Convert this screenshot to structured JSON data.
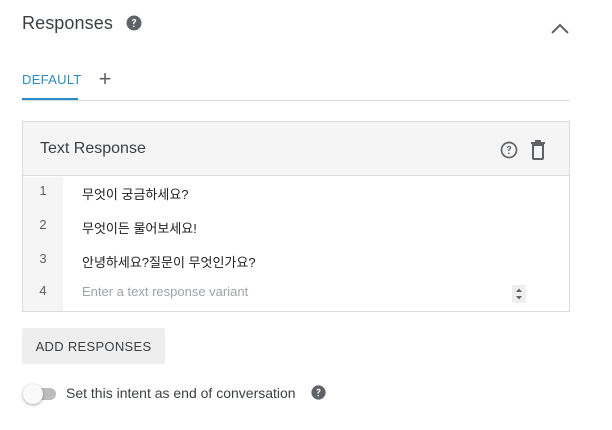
{
  "header": {
    "title": "Responses",
    "help_icon": "help-circle-icon",
    "collapse_icon": "chevron-up-icon"
  },
  "tabs": {
    "active_label": "DEFAULT",
    "add_icon": "plus-icon",
    "add_symbol": "+"
  },
  "card": {
    "title": "Text Response",
    "help_icon": "help-outline-icon",
    "delete_icon": "trash-icon",
    "rows": [
      {
        "num": "1",
        "text": "무엇이 궁금하세요?"
      },
      {
        "num": "2",
        "text": "무엇이든 물어보세요!"
      },
      {
        "num": "3",
        "text": "안녕하세요?질문이 무엇인가요?"
      },
      {
        "num": "4",
        "placeholder": "Enter a text response variant"
      }
    ]
  },
  "actions": {
    "add_responses": "ADD RESPONSES"
  },
  "end_conversation": {
    "label": "Set this intent as end of conversation",
    "enabled": false,
    "help_icon": "help-circle-icon"
  },
  "colors": {
    "accent": "#2a8cc4",
    "header_bg": "#f5f5f5",
    "border": "#dadce0",
    "button_bg": "#eeeeee"
  }
}
